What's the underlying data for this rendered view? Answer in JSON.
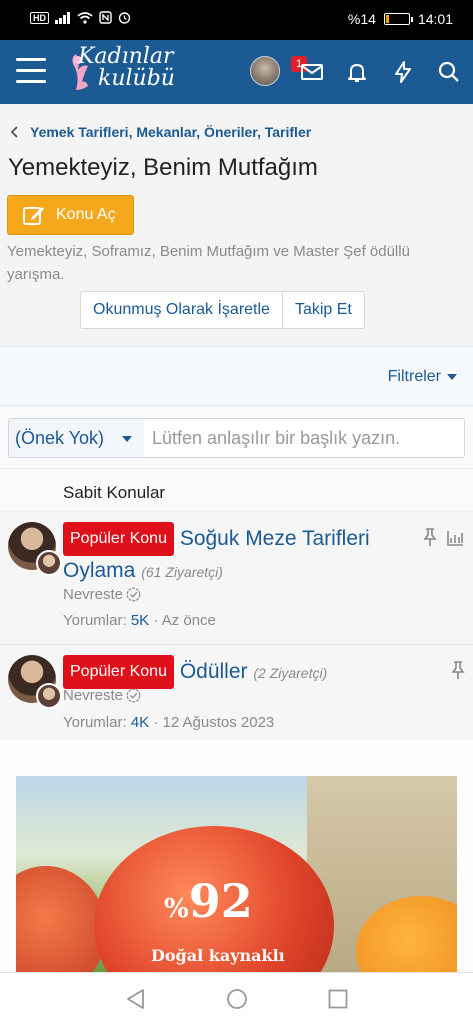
{
  "status_bar": {
    "left_badge": "HD",
    "battery_percent": "%14",
    "battery_level": 0.14,
    "time": "14:01"
  },
  "header": {
    "logo_line1": "Kadınlar",
    "logo_line2": "kulübü",
    "notification_count": "1",
    "accent_color": "#1b5a93"
  },
  "breadcrumb": {
    "label": "Yemek Tarifleri, Mekanlar, Öneriler, Tarifler"
  },
  "forum": {
    "title": "Yemekteyiz, Benim Mutfağım",
    "new_thread_label": "Konu Aç",
    "description": "Yemekteyiz, Soframız, Benim Mutfağım ve Master Şef ödüllü yarışma.",
    "mark_read_label": "Okunmuş Olarak İşaretle",
    "follow_label": "Takip Et"
  },
  "filters": {
    "label": "Filtreler"
  },
  "quick_thread": {
    "prefix_value": "(Önek Yok)",
    "title_placeholder": "Lütfen anlaşılır bir başlık yazın."
  },
  "sticky": {
    "header": "Sabit Konular"
  },
  "threads": [
    {
      "label": "Popüler Konu",
      "title": "Soğuk Meze Tarifleri Oylama",
      "visitors": "(61 Ziyaretçi)",
      "author": "Nevreste",
      "replies_label": "Yorumlar:",
      "replies": "5K",
      "time": "· Az önce"
    },
    {
      "label": "Popüler Konu",
      "title": "Ödüller",
      "visitors": "(2 Ziyaretçi)",
      "author": "Nevreste",
      "replies_label": "Yorumlar:",
      "replies": "4K",
      "time": "· 12 Ağustos 2023"
    }
  ],
  "ad": {
    "percent_sign": "%",
    "percent_value": "92",
    "subtitle": "Doğal kaynaklı"
  },
  "icons": [
    "hamburger-icon",
    "mail-icon",
    "bell-icon",
    "bolt-icon",
    "search-icon",
    "pencil-icon",
    "chevron-left-icon",
    "pin-icon",
    "stats-icon",
    "verified-icon",
    "back-icon",
    "home-icon",
    "recents-icon"
  ]
}
